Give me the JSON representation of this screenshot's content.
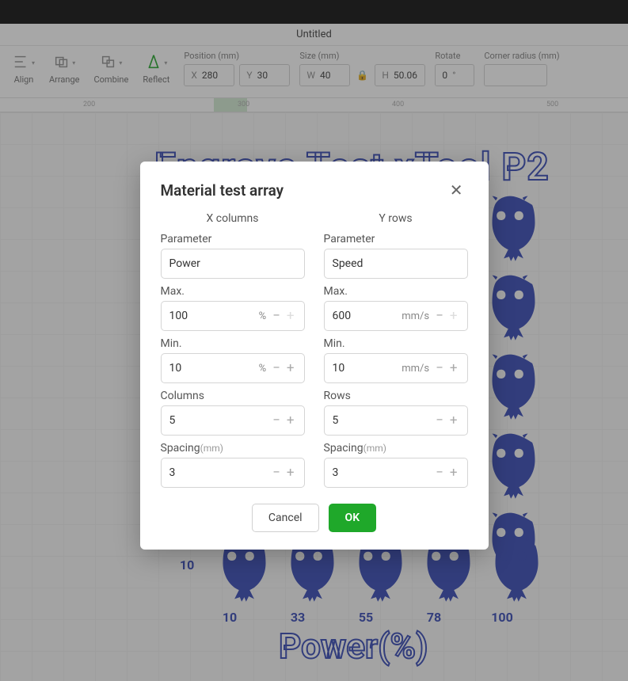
{
  "titlebar": {
    "title": "Untitled"
  },
  "toolbar": {
    "align_label": "Align",
    "arrange_label": "Arrange",
    "combine_label": "Combine",
    "reflect_label": "Reflect",
    "position_group": "Position (mm)",
    "size_group": "Size (mm)",
    "rotate_group": "Rotate",
    "corner_group": "Corner radius (mm)",
    "x_prefix": "X",
    "x_value": "280",
    "y_prefix": "Y",
    "y_value": "30",
    "w_prefix": "W",
    "w_value": "40",
    "h_prefix": "H",
    "h_value": "50.06",
    "rotate_value": "0",
    "rotate_unit": "°",
    "corner_value": ""
  },
  "ruler": {
    "t200": "200",
    "t300": "300",
    "t400": "400",
    "t500": "500"
  },
  "artwork": {
    "title_text_a": "Engrave Test",
    "title_text_b": "xTool P2",
    "y_val_10": "10",
    "x_vals": [
      "10",
      "33",
      "55",
      "78",
      "100"
    ],
    "power_label": "Power(%)"
  },
  "dialog": {
    "title": "Material test array",
    "xcol_header": "X columns",
    "ycol_header": "Y rows",
    "left": {
      "parameter_label": "Parameter",
      "parameter_value": "Power",
      "max_label": "Max.",
      "max_value": "100",
      "max_unit": "%",
      "min_label": "Min.",
      "min_value": "10",
      "min_unit": "%",
      "count_label": "Columns",
      "count_value": "5",
      "spacing_label": "Spacing",
      "spacing_unit_label": "(mm)",
      "spacing_value": "3"
    },
    "right": {
      "parameter_label": "Parameter",
      "parameter_value": "Speed",
      "max_label": "Max.",
      "max_value": "600",
      "max_unit": "mm/s",
      "min_label": "Min.",
      "min_value": "10",
      "min_unit": "mm/s",
      "count_label": "Rows",
      "count_value": "5",
      "spacing_label": "Spacing",
      "spacing_unit_label": "(mm)",
      "spacing_value": "3"
    },
    "cancel": "Cancel",
    "ok": "OK"
  }
}
